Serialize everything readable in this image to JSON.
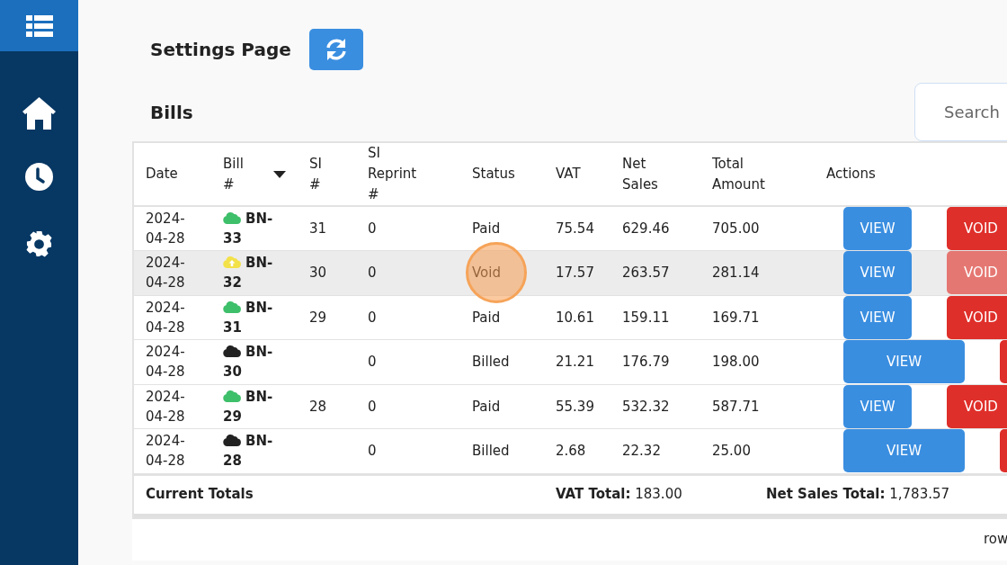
{
  "page_title": "Settings Page",
  "section_title": "Bills",
  "search": {
    "placeholder": "Search"
  },
  "table": {
    "columns": [
      {
        "label": "Date",
        "sortable": false
      },
      {
        "label": "Bill #",
        "sortable": true
      },
      {
        "label": "SI #",
        "sortable": false
      },
      {
        "label": "SI Reprint #",
        "sortable": false
      },
      {
        "label": "Status",
        "sortable": false
      },
      {
        "label": "VAT",
        "sortable": false
      },
      {
        "label": "Net Sales",
        "sortable": false
      },
      {
        "label": "Total Amount",
        "sortable": false
      },
      {
        "label": "Actions",
        "sortable": false
      }
    ],
    "rows": [
      {
        "date": "2024-04-28",
        "bill": {
          "text": "BN-33",
          "kind": "synced",
          "color": "#3ebf6a"
        },
        "si": "31",
        "si_reprint": "0",
        "status": "Paid",
        "vat": "75.54",
        "net_sales": "629.46",
        "total": "705.00",
        "hovered": false,
        "click_marker": false,
        "actions": [
          {
            "kind": "view",
            "label": "VIEW"
          },
          {
            "kind": "void",
            "label": "VOID",
            "disabled": false
          }
        ]
      },
      {
        "date": "2024-04-28",
        "bill": {
          "text": "BN-32",
          "kind": "uploading",
          "color": "#f3e14a"
        },
        "si": "30",
        "si_reprint": "0",
        "status": "Void",
        "vat": "17.57",
        "net_sales": "263.57",
        "total": "281.14",
        "hovered": true,
        "click_marker": true,
        "actions": [
          {
            "kind": "view",
            "label": "VIEW"
          },
          {
            "kind": "void",
            "label": "VOID",
            "disabled": true
          }
        ]
      },
      {
        "date": "2024-04-28",
        "bill": {
          "text": "BN-31",
          "kind": "synced",
          "color": "#3ebf6a"
        },
        "si": "29",
        "si_reprint": "0",
        "status": "Paid",
        "vat": "10.61",
        "net_sales": "159.11",
        "total": "169.71",
        "hovered": false,
        "click_marker": false,
        "actions": [
          {
            "kind": "view",
            "label": "VIEW"
          },
          {
            "kind": "void",
            "label": "VOID",
            "disabled": false
          }
        ]
      },
      {
        "date": "2024-04-28",
        "bill": {
          "text": "BN-30",
          "kind": "synced",
          "color": "#222222"
        },
        "si_reprint": "0",
        "status": "Billed",
        "vat": "21.21",
        "net_sales": "176.79",
        "total": "198.00",
        "hovered": false,
        "click_marker": false,
        "actions": [
          {
            "kind": "view-wide",
            "label": "VIEW"
          },
          {
            "kind": "danger-cut"
          }
        ]
      },
      {
        "date": "2024-04-28",
        "bill": {
          "text": "BN-29",
          "kind": "synced",
          "color": "#3ebf6a"
        },
        "si": "28",
        "si_reprint": "0",
        "status": "Paid",
        "vat": "55.39",
        "net_sales": "532.32",
        "total": "587.71",
        "hovered": false,
        "click_marker": false,
        "actions": [
          {
            "kind": "view",
            "label": "VIEW"
          },
          {
            "kind": "void",
            "label": "VOID",
            "disabled": false
          }
        ]
      },
      {
        "date": "2024-04-28",
        "bill": {
          "text": "BN-28",
          "kind": "synced",
          "color": "#222222"
        },
        "si_reprint": "0",
        "status": "Billed",
        "vat": "2.68",
        "net_sales": "22.32",
        "total": "25.00",
        "hovered": false,
        "click_marker": false,
        "actions": [
          {
            "kind": "view-wide",
            "label": "VIEW"
          },
          {
            "kind": "danger-cut"
          }
        ]
      }
    ]
  },
  "totals": {
    "label": "Current Totals",
    "items": [
      {
        "label": "VAT Total:",
        "value": "183.00"
      },
      {
        "label": "Net Sales Total:",
        "value": "1,783.57"
      }
    ]
  },
  "pagination": {
    "text": "row"
  }
}
